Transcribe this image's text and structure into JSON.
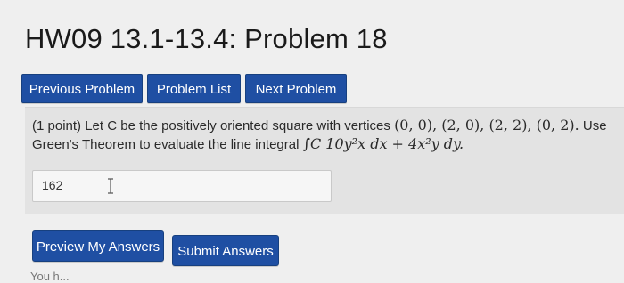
{
  "page": {
    "title": "HW09 13.1-13.4: Problem 18"
  },
  "nav": {
    "previous_label": "Previous Problem",
    "list_label": "Problem List",
    "next_label": "Next Problem"
  },
  "problem": {
    "points": "(1 point)",
    "text_line1": "Let C be the positively oriented square with vertices",
    "vertices": "(0, 0), (2, 0), (2, 2), (0, 2).",
    "text_use": "Use",
    "text_line2": "Green's Theorem to evaluate the line integral",
    "integral": "∫C 10y²x dx + 4x²y dy."
  },
  "answer": {
    "value": "162"
  },
  "actions": {
    "preview_label": "Preview My Answers",
    "submit_label": "Submit Answers"
  },
  "footer": {
    "partial_text": "You h..."
  },
  "colors": {
    "button_bg": "#1f4fa3",
    "page_bg": "#efefef",
    "problem_bg": "#e3e3e3"
  }
}
